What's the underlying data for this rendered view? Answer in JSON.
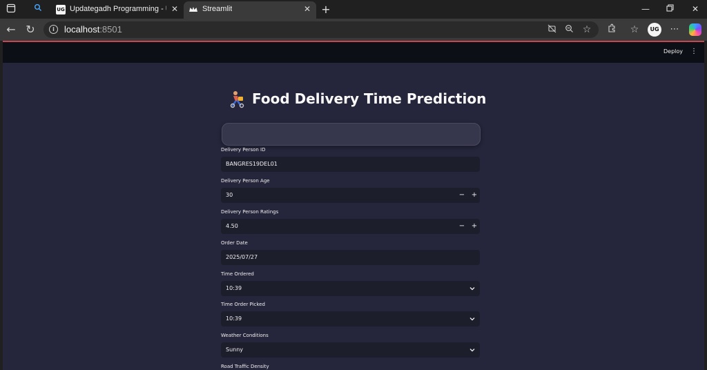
{
  "browser": {
    "tabs": [
      {
        "title": "Updategadh Programming - Upd",
        "favicon": "UG",
        "active": false
      },
      {
        "title": "Streamlit",
        "favicon": "crown",
        "active": true
      }
    ],
    "url_host": "localhost",
    "url_port": ":8501",
    "profile_initials": "UG"
  },
  "header": {
    "deploy_label": "Deploy"
  },
  "page": {
    "title": "Food Delivery Time Prediction",
    "title_emoji": "delivery-rider"
  },
  "form": {
    "delivery_person_id": {
      "label": "Delivery Person ID",
      "value": "BANGRES19DEL01"
    },
    "delivery_person_age": {
      "label": "Delivery Person Age",
      "value": "30"
    },
    "delivery_person_ratings": {
      "label": "Delivery Person Ratings",
      "value": "4.50"
    },
    "order_date": {
      "label": "Order Date",
      "value": "2025/07/27"
    },
    "time_ordered": {
      "label": "Time Ordered",
      "value": "10:39"
    },
    "time_order_picked": {
      "label": "Time Order Picked",
      "value": "10:39"
    },
    "weather_conditions": {
      "label": "Weather Conditions",
      "value": "Sunny"
    },
    "road_traffic_density": {
      "label": "Road Traffic Density"
    }
  },
  "colors": {
    "background": "#25253b",
    "header": "#0d0f16",
    "input": "#1d1e2c",
    "accent_line": "#c4484f"
  }
}
